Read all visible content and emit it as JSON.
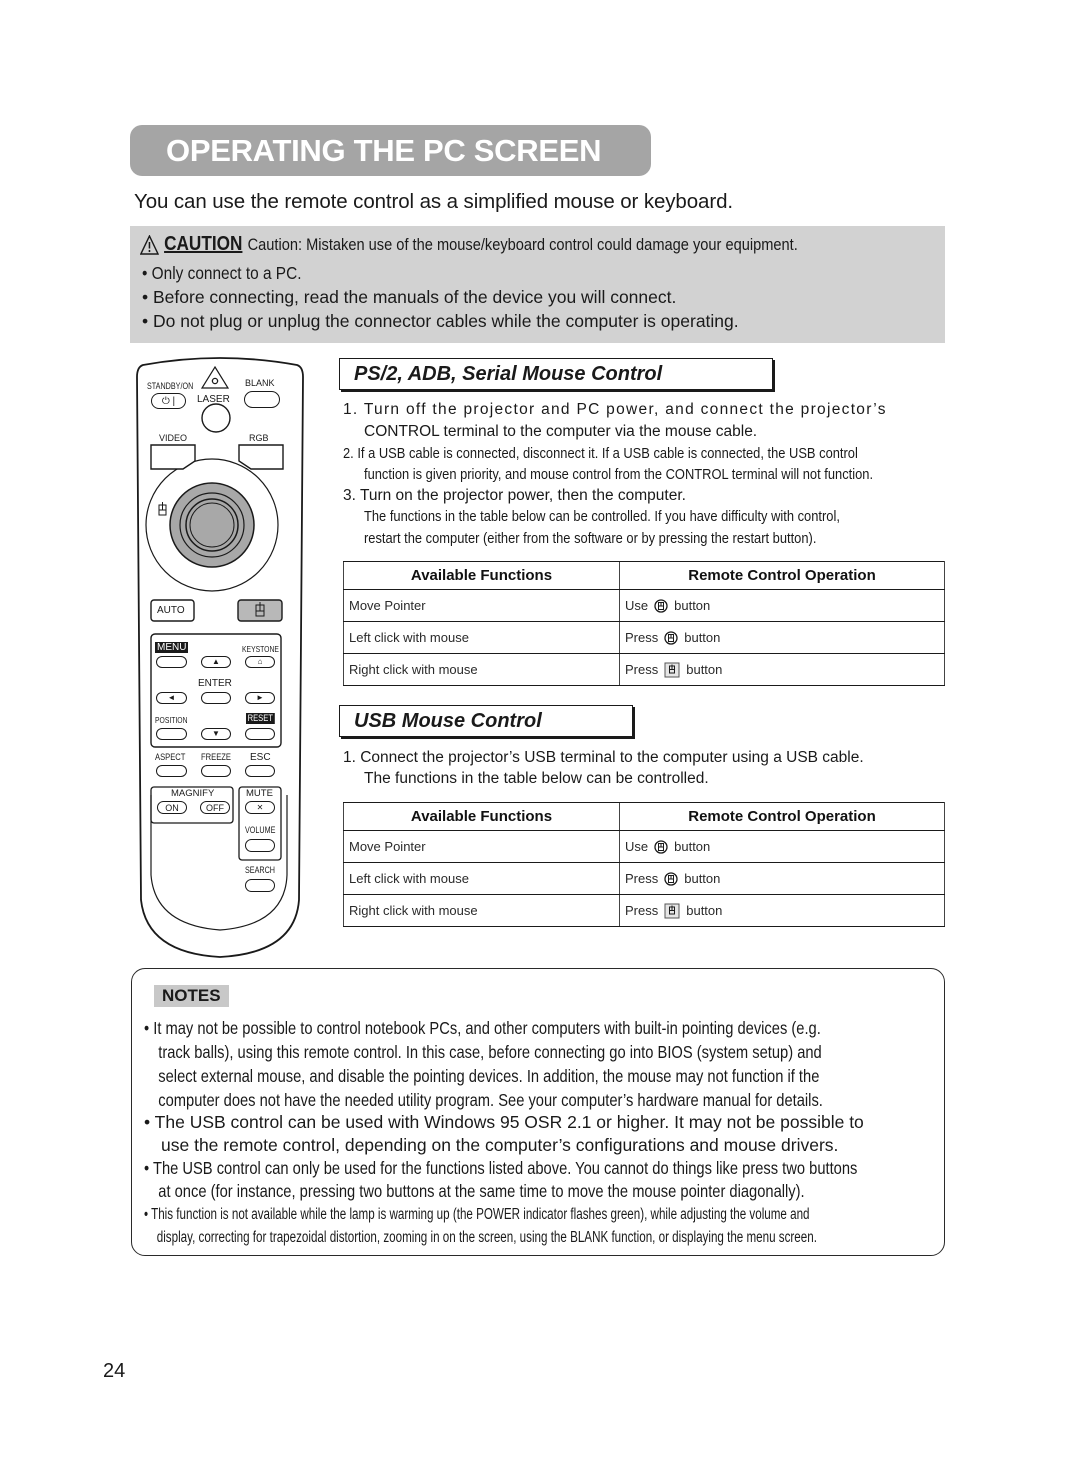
{
  "header": {
    "title": "OPERATING THE PC SCREEN",
    "intro": "You can use the remote control as a simplified mouse or keyboard."
  },
  "caution": {
    "icon": "warning-triangle-icon",
    "word": "CAUTION",
    "text": "Caution: Mistaken use of the mouse/keyboard control could damage your equipment.",
    "bullets": [
      "• Only connect to a PC.",
      "• Before connecting, read the manuals of the device you will connect.",
      "• Do not plug or unplug the connector cables while the computer is operating."
    ]
  },
  "remote": {
    "labels": {
      "standby": "STANDBY/ON",
      "laser": "LASER",
      "blank": "BLANK",
      "video": "VIDEO",
      "rgb": "RGB",
      "auto": "AUTO",
      "menu": "MENU",
      "keystone": "KEYSTONE",
      "enter": "ENTER",
      "position": "POSITION",
      "reset": "RESET",
      "aspect": "ASPECT",
      "freeze": "FREEZE",
      "esc": "ESC",
      "magnify": "MAGNIFY",
      "on": "ON",
      "off": "OFF",
      "mute": "MUTE",
      "volume": "VOLUME",
      "search": "SEARCH"
    },
    "glyphs": {
      "power": "⏻ |",
      "up": "▲",
      "down": "▼",
      "left": "◄",
      "right": "►",
      "mute": "🔇"
    }
  },
  "ps2_section": {
    "heading": "PS/2, ADB, Serial Mouse Control",
    "steps": [
      "1. Turn off the projector and PC power, and connect the projector’s",
      "CONTROL terminal to the computer via the mouse cable.",
      "2. If a USB cable is connected, disconnect it. If a USB cable is connected, the USB control",
      "function is given priority, and mouse control from the CONTROL terminal will not function.",
      "3. Turn on the projector power, then the computer.",
      "The functions in the table below can be controlled. If you have difficulty with control,",
      "restart the computer (either from the software or by pressing the restart button)."
    ],
    "table": {
      "headers": [
        "Available Functions",
        "Remote Control Operation"
      ],
      "rows": [
        {
          "function": "Move Pointer",
          "verb": "Use",
          "icon": "mouse-disk-icon",
          "suffix": "button"
        },
        {
          "function": "Left click with mouse",
          "verb": "Press",
          "icon": "mouse-disk-icon",
          "suffix": "button"
        },
        {
          "function": "Right click with mouse",
          "verb": "Press",
          "icon": "mouse-square-icon",
          "suffix": "button"
        }
      ]
    }
  },
  "usb_section": {
    "heading": "USB Mouse Control",
    "steps": [
      "1. Connect the projector’s USB terminal to the computer using a USB cable.",
      "The functions in the table below can be controlled."
    ],
    "table": {
      "headers": [
        "Available Functions",
        "Remote Control Operation"
      ],
      "rows": [
        {
          "function": "Move Pointer",
          "verb": "Use",
          "icon": "mouse-disk-icon",
          "suffix": "button"
        },
        {
          "function": "Left click with mouse",
          "verb": "Press",
          "icon": "mouse-disk-icon",
          "suffix": "button"
        },
        {
          "function": "Right click with mouse",
          "verb": "Press",
          "icon": "mouse-square-icon",
          "suffix": "button"
        }
      ]
    }
  },
  "notes": {
    "label": "NOTES",
    "items": [
      {
        "lines": [
          "• It may not be possible to control notebook PCs, and other computers with built-in pointing devices (e.g.",
          "track balls), using this remote control. In this case, before connecting go into BIOS (system setup) and",
          "select external mouse, and disable the pointing devices. In addition, the mouse may not function if the",
          "computer does not have the needed utility program. See your computer’s hardware manual for details."
        ]
      },
      {
        "lines": [
          "• The USB control can be used with Windows 95 OSR 2.1 or higher. It may not be possible to",
          "use the remote control, depending on the computer’s configurations and mouse drivers."
        ]
      },
      {
        "lines": [
          "• The USB control can only be used for the functions listed above. You cannot do things like press two buttons",
          "at once (for instance, pressing two buttons at the same time to move the mouse pointer diagonally)."
        ]
      },
      {
        "lines": [
          "• This function is not available while the lamp is warming up (the POWER indicator flashes green), while adjusting the volume and",
          "display, correcting for trapezoidal distortion, zooming in on the screen, using the BLANK function, or displaying the menu screen."
        ]
      }
    ]
  },
  "footer": {
    "page_number": "24"
  },
  "colors": {
    "title_bg": "#a5a5a5",
    "caution_bg": "#d2d2d2",
    "notes_label_bg": "#c8c8c8",
    "joystick_fill": "#a8a8a8"
  }
}
